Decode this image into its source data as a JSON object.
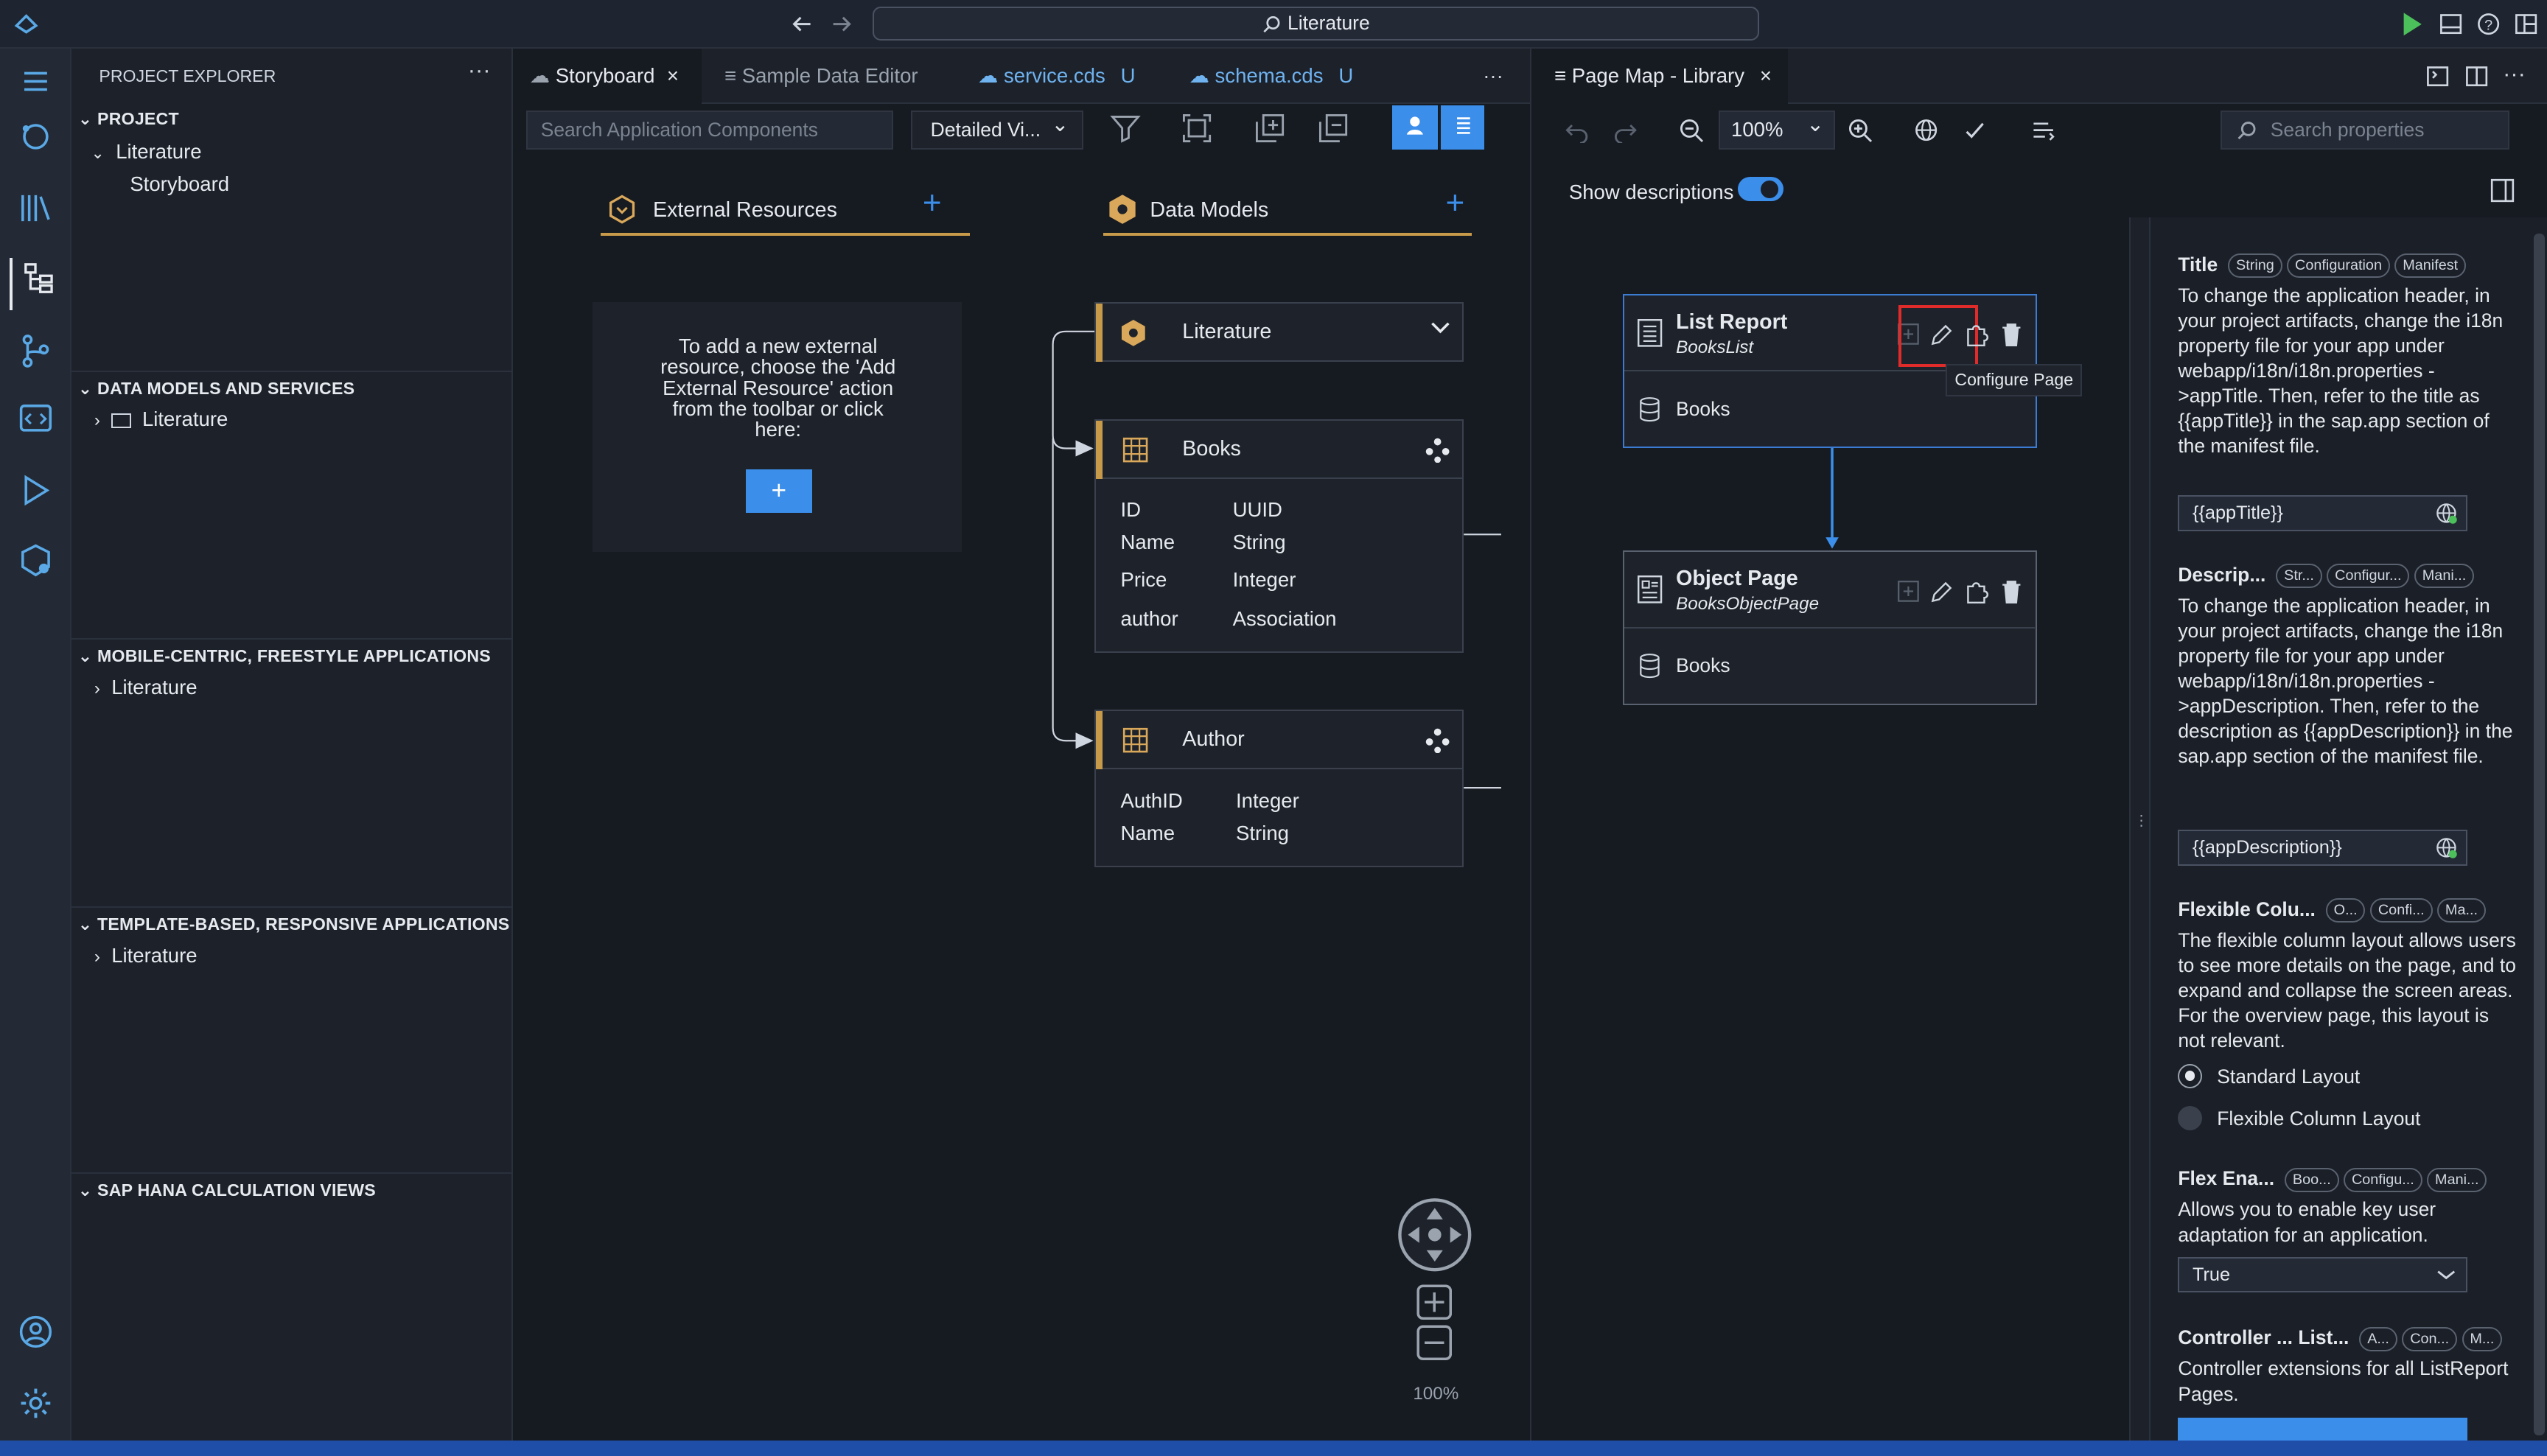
{
  "titlebar": {
    "command": "Literature"
  },
  "explorer": {
    "title": "PROJECT EXPLORER",
    "project": {
      "header": "PROJECT",
      "root": "Literature",
      "child": "Storyboard"
    },
    "data_models": {
      "header": "DATA MODELS AND SERVICES",
      "item": "Literature"
    },
    "mobile": {
      "header": "MOBILE-CENTRIC, FREESTYLE APPLICATIONS",
      "item": "Literature"
    },
    "template": {
      "header": "TEMPLATE-BASED, RESPONSIVE APPLICATIONS",
      "item": "Literature"
    },
    "hana": {
      "header": "SAP HANA CALCULATION VIEWS"
    }
  },
  "tabs": [
    {
      "label": "Storyboard",
      "marker": ""
    },
    {
      "label": "Sample Data Editor",
      "marker": ""
    },
    {
      "label": "service.cds",
      "marker": "U"
    },
    {
      "label": "schema.cds",
      "marker": "U"
    }
  ],
  "storyboard": {
    "search_placeholder": "Search Application Components",
    "view_select": "Detailed Vi...",
    "external": {
      "title": "External Resources",
      "hint": "To add a new external resource, choose the 'Add External Resource' action from the toolbar or click here:",
      "add": "+"
    },
    "data_models": {
      "title": "Data Models"
    },
    "service": {
      "name": "Literature"
    },
    "books": {
      "name": "Books",
      "fields": [
        {
          "name": "ID",
          "type": "UUID"
        },
        {
          "name": "Name",
          "type": "String"
        },
        {
          "name": "Price",
          "type": "Integer"
        },
        {
          "name": "author",
          "type": "Association"
        }
      ]
    },
    "author": {
      "name": "Author",
      "fields": [
        {
          "name": "AuthID",
          "type": "Integer"
        },
        {
          "name": "Name",
          "type": "String"
        }
      ]
    },
    "zoom": "100%"
  },
  "pagemap": {
    "tab": "Page Map - Library",
    "zoom": "100%",
    "search_placeholder": "Search properties",
    "show_descriptions": "Show descriptions",
    "show_descriptions_on": true,
    "list_report": {
      "title": "List Report",
      "subtitle": "BooksList",
      "entity": "Books"
    },
    "object_page": {
      "title": "Object Page",
      "subtitle": "BooksObjectPage",
      "entity": "Books"
    },
    "tooltip": "Configure Page"
  },
  "properties": {
    "title": {
      "label": "Title",
      "tags": [
        "String",
        "Configuration",
        "Manifest"
      ],
      "desc": "To change the application header, in your project artifacts, change the i18n property file for your app under webapp/i18n/i18n.properties ->appTitle. Then, refer to the title as {{appTitle}} in the sap.app section of the manifest file.",
      "value": "{{appTitle}}"
    },
    "description": {
      "label": "Descrip...",
      "tags": [
        "Str...",
        "Configur...",
        "Mani..."
      ],
      "desc": "To change the application header, in your project artifacts, change the i18n property file for your app under webapp/i18n/i18n.properties ->appDescription. Then, refer to the description as {{appDescription}} in the sap.app section of the manifest file.",
      "value": "{{appDescription}}"
    },
    "flexible": {
      "label": "Flexible Colu...",
      "tags": [
        "O...",
        "Confi...",
        "Ma..."
      ],
      "desc": "The flexible column layout allows users to see more details on the page, and to expand and collapse the screen areas. For the overview page, this layout is not relevant.",
      "options": [
        "Standard Layout",
        "Flexible Column Layout"
      ],
      "selected": "Standard Layout"
    },
    "flex_enabled": {
      "label": "Flex Ena...",
      "tags": [
        "Boo...",
        "Configu...",
        "Mani..."
      ],
      "desc": "Allows you to enable key user adaptation for an application.",
      "value": "True"
    },
    "controller": {
      "label": "Controller ... List...",
      "tags": [
        "A...",
        "Con...",
        "M..."
      ],
      "desc": "Controller extensions for all ListReport Pages."
    }
  },
  "colors": {
    "accent": "#3b8eea",
    "gold": "#c79a4a",
    "background": "#161a21"
  }
}
